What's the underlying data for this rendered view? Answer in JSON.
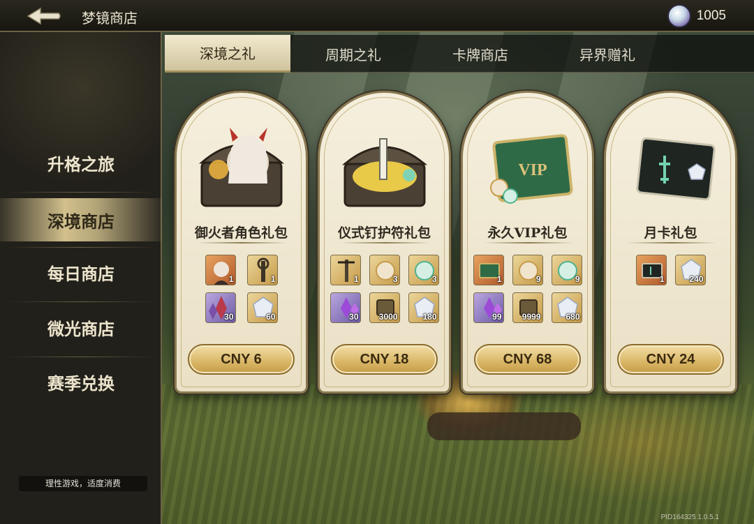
{
  "header": {
    "title": "梦镜商店",
    "currency_amount": "1005"
  },
  "sidebar": {
    "items": [
      {
        "label": "升格之旅"
      },
      {
        "label": "深境商店"
      },
      {
        "label": "每日商店"
      },
      {
        "label": "微光商店"
      },
      {
        "label": "赛季兑换"
      }
    ],
    "active_index": 1,
    "notice": "理性游戏，适度消费"
  },
  "tabs": [
    {
      "label": "深境之礼"
    },
    {
      "label": "周期之礼"
    },
    {
      "label": "卡牌商店"
    },
    {
      "label": "异界赠礼"
    }
  ],
  "active_tab": 0,
  "cards": [
    {
      "title": "御火者角色礼包",
      "price": "CNY 6",
      "items": [
        {
          "icon": "character-portrait-icon",
          "qty": "1"
        },
        {
          "icon": "totem-key-icon",
          "qty": "1"
        },
        {
          "icon": "crystal-cluster-icon",
          "qty": "30"
        },
        {
          "icon": "prism-gem-icon",
          "qty": "60"
        }
      ]
    },
    {
      "title": "仪式钉护符礼包",
      "price": "CNY 18",
      "items": [
        {
          "icon": "ritual-nail-icon",
          "qty": "1"
        },
        {
          "icon": "orb-gold-icon",
          "qty": "3"
        },
        {
          "icon": "orb-green-icon",
          "qty": "3"
        },
        {
          "icon": "crystal-cluster-icon",
          "qty": "30"
        },
        {
          "icon": "scroll-tablet-icon",
          "qty": "3000"
        },
        {
          "icon": "prism-gem-icon",
          "qty": "180"
        }
      ]
    },
    {
      "title": "永久VIP礼包",
      "price": "CNY 68",
      "items": [
        {
          "icon": "vip-card-icon",
          "qty": "1"
        },
        {
          "icon": "orb-gold-icon",
          "qty": "9"
        },
        {
          "icon": "orb-green-icon",
          "qty": "9"
        },
        {
          "icon": "crystal-cluster-icon",
          "qty": "99"
        },
        {
          "icon": "scroll-tablet-icon",
          "qty": "9999"
        },
        {
          "icon": "prism-gem-icon",
          "qty": "680"
        }
      ]
    },
    {
      "title": "月卡礼包",
      "price": "CNY 24",
      "items": [
        {
          "icon": "month-card-icon",
          "qty": "1"
        },
        {
          "icon": "prism-gem-icon",
          "qty": "240"
        }
      ]
    }
  ],
  "version": "PID164325  1.0.5.1",
  "colors": {
    "accent_gold": "#d9b666",
    "panel_cream": "#f5efdd",
    "dark_frame": "#22201a"
  }
}
